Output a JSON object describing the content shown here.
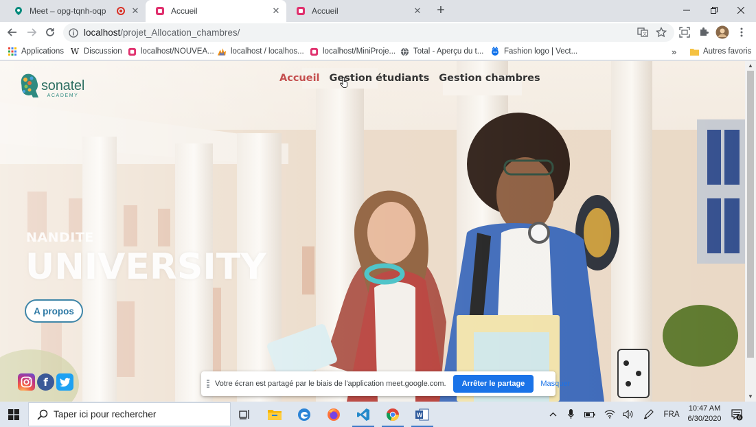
{
  "browser": {
    "tabs": [
      {
        "title": "Meet – opg-tqnh-oqp",
        "recording": true
      },
      {
        "title": "Accueil",
        "active": true
      },
      {
        "title": "Accueil"
      }
    ],
    "url_host": "localhost",
    "url_path": "/projet_Allocation_chambres/",
    "bookmarks": [
      {
        "label": "Applications",
        "icon": "apps-grid-icon"
      },
      {
        "label": "Discussion",
        "icon": "wikipedia-icon"
      },
      {
        "label": "localhost/NOUVEA...",
        "icon": "site-icon"
      },
      {
        "label": "localhost / localhos...",
        "icon": "phpmyadmin-icon"
      },
      {
        "label": "localhost/MiniProje...",
        "icon": "site-icon"
      },
      {
        "label": "Total - Aperçu du t...",
        "icon": "globe-icon"
      },
      {
        "label": "Fashion logo | Vect...",
        "icon": "freepik-icon"
      }
    ],
    "bookmarks_overflow": "»",
    "other_bookmarks": "Autres favoris"
  },
  "site": {
    "logo_name": "sonatel",
    "logo_sub": "ACADEMY",
    "nav": [
      {
        "label": "Accueil",
        "active": true
      },
      {
        "label": "Gestion étudiants"
      },
      {
        "label": "Gestion chambres"
      }
    ],
    "hero_kicker": "NANDITE",
    "hero_title": "UNIVERSITY",
    "about_button": "A propos",
    "social": [
      "instagram-icon",
      "facebook-icon",
      "twitter-icon"
    ]
  },
  "share_bar": {
    "message": "Votre écran est partagé par le biais de l'application meet.google.com.",
    "stop_label": "Arrêter le partage",
    "hide_label": "Masquer"
  },
  "taskbar": {
    "search_placeholder": "Taper ici pour rechercher",
    "language": "FRA",
    "time": "10:47 AM",
    "date": "6/30/2020",
    "notifications": "6"
  },
  "colors": {
    "nav_active": "#c44e4e",
    "brand_teal": "#2e6f62",
    "chrome_accent": "#1a73e8"
  }
}
